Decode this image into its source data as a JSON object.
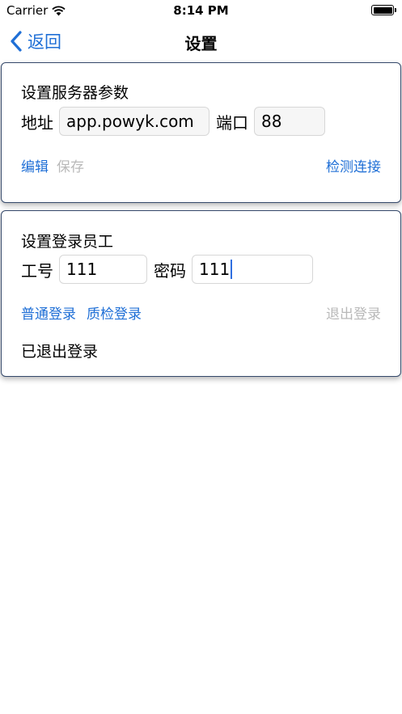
{
  "status_bar": {
    "carrier": "Carrier",
    "time": "8:14 PM"
  },
  "nav": {
    "back_label": "返回",
    "title": "设置"
  },
  "server": {
    "title": "设置服务器参数",
    "address_label": "地址",
    "address_value": "app.powyk.com",
    "port_label": "端口",
    "port_value": "88",
    "edit_label": "编辑",
    "save_label": "保存",
    "test_label": "检测连接"
  },
  "login": {
    "title": "设置登录员工",
    "id_label": "工号",
    "id_value": "111",
    "password_label": "密码",
    "password_value": "111",
    "normal_login_label": "普通登录",
    "qc_login_label": "质检登录",
    "logout_label": "退出登录",
    "status": "已退出登录"
  },
  "colors": {
    "accent": "#1f6fd6",
    "disabled": "#b9b9b9",
    "card_border": "#34486a"
  }
}
